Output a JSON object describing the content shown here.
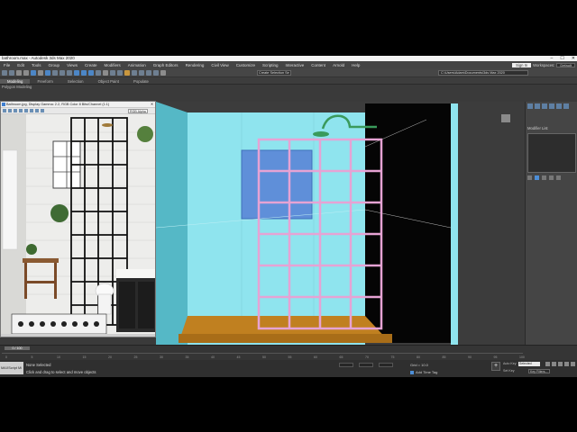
{
  "window": {
    "title": "bathroom.max - Autodesk 3ds Max 2020",
    "controls": [
      "–",
      "☐",
      "✕"
    ]
  },
  "menu": {
    "items": [
      "File",
      "Edit",
      "Tools",
      "Group",
      "Views",
      "Create",
      "Modifiers",
      "Animation",
      "Graph Editors",
      "Rendering",
      "Civil View",
      "Customize",
      "Scripting",
      "Interactive",
      "Content",
      "Arnold",
      "Help"
    ],
    "sign_in": "Sign In",
    "workspaces_label": "Workspaces:",
    "workspaces_value": "Default"
  },
  "toolbar": {
    "selection_set": "Create Selection Se",
    "project_path": "C:\\Users\\Adam\\Documents\\3ds Max 2020"
  },
  "ribbon": {
    "tabs": [
      "Modeling",
      "Freeform",
      "Selection",
      "Object Paint",
      "Populate"
    ],
    "active_tab": "Modeling",
    "sub_label": "Polygon Modeling"
  },
  "image_viewer": {
    "title": "Bathroom.jpg, Display Gamma: 2.2, RGB Color 8 Bits/Channel (1:1)",
    "channel": "RGB Alpha"
  },
  "command_panel": {
    "modifier_list_label": "Modifier List"
  },
  "timeline": {
    "frame": "0 / 100",
    "ticks": [
      "0",
      "5",
      "10",
      "15",
      "20",
      "25",
      "30",
      "35",
      "40",
      "45",
      "50",
      "55",
      "60",
      "65",
      "70",
      "75",
      "80",
      "85",
      "90",
      "95",
      "100"
    ]
  },
  "status": {
    "maxscript": "MAXScript Mi",
    "selection": "None Selected",
    "hint": "Click and drag to select and move objects",
    "grid": "Grid = 10.0",
    "add_time_tag": "Add Time Tag",
    "auto_key": "Auto Key",
    "set_key": "Set Key",
    "selected_dropdown": "Selected",
    "key_filters": "Key Filters..."
  },
  "colors": {
    "wall": "#8fe4ee",
    "frame": "#e6a3d4",
    "window_glass": "#5f8fd9",
    "floor": "#c08020",
    "shower_head": "#3a9a5c",
    "dark_opening": "#050505"
  }
}
